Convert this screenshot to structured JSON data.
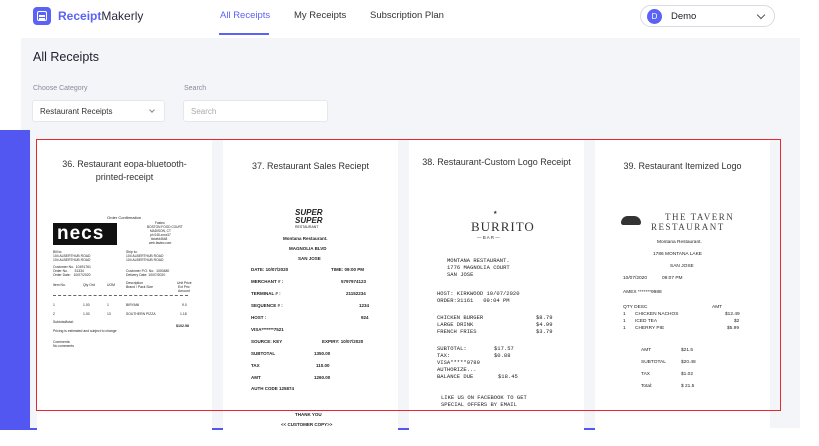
{
  "header": {
    "brand_bold": "Receipt",
    "brand_rest": "Makerly",
    "nav": [
      "All Receipts",
      "My Receipts",
      "Subscription Plan"
    ],
    "user_initial": "D",
    "user_name": "Demo"
  },
  "main": {
    "heading": "All Receipts",
    "category_label": "Choose Category",
    "category_value": "Restaurant Receipts",
    "search_label": "Search",
    "search_placeholder": "Search"
  },
  "cards": [
    {
      "title": "36. Restaurant eopa-bluetooth-printed-receipt",
      "receipt": {
        "confirmation": "Order Confirmation",
        "logo": "necs",
        "store_lines": [
          "Fasteo",
          "BOSTON FOOD COURT",
          "MADISON, CT",
          "ph 045-xxxx37",
          "ticket#4648",
          "web.fasteo.com"
        ],
        "bill_to": [
          "Bill to:",
          "104 ALBERTHUB ROAD",
          "104 ALBERTHUB ROAD"
        ],
        "ship_to": [
          "Ship to:",
          "104 ALBERTHUB ROAD",
          "104 ALBERTHUB ROAD"
        ],
        "meta_left": [
          "Customer No.  10491761",
          "Order No.       31334",
          "Order Date:   10/07/2020"
        ],
        "meta_right": [
          "Customer P.O. No.  1000480",
          "Delivery Date: 10/07/2020"
        ],
        "cols": [
          "Item No.",
          "Qty Ord",
          "UOM",
          "Description",
          "Unit Price"
        ],
        "col_sub": [
          "Brand / Pack Size",
          "Ext Pric",
          "Amount"
        ],
        "rows": [
          [
            "1",
            "1.00",
            "1",
            "BIRYANI",
            "9.0"
          ],
          [
            "2",
            "1.00",
            "13",
            "SOUTHERN PIZZA",
            "1.18"
          ]
        ],
        "subtotal_label": "Subtotal/total:",
        "subtotal_value": "$102.98",
        "note": "Pricing is estimated and subject to change",
        "comments": "Comments:",
        "comments_value": "No comments"
      }
    },
    {
      "title": "37. Restaurant Sales Reciept",
      "receipt": {
        "logo_lines": [
          "SUPER",
          "SUPER"
        ],
        "logo_sub": "RESTAURANT",
        "name": "Montana Restaurant.",
        "street": "MAGNOLIA BLVD",
        "city": "SAN JOSE",
        "date": "DATE: 10/07/2020",
        "time": "TIME: 09:00 PM",
        "rows": [
          [
            "MERCHANT # :",
            "5797974123"
          ],
          [
            "TERMINAL # :",
            "21152234"
          ],
          [
            "SEQUENCE # :",
            "1234"
          ],
          [
            "HOST :",
            "924"
          ]
        ],
        "visa": "VISA*******7521",
        "source": "SOURCE: KEY",
        "expiry": "EXPIRY: 10/07/2020",
        "totals": [
          [
            "SUBTOTAL",
            "1350.00"
          ],
          [
            "TAX",
            "110.00"
          ],
          [
            "AMT",
            "1260.00"
          ]
        ],
        "auth": "AUTH CODE 125874",
        "thanks": "THANK YOU",
        "copy": "<< CUSTOMER COPY>>"
      }
    },
    {
      "title": "38. Restaurant-Custom Logo Receipt",
      "receipt": {
        "logo": "BURRITO",
        "logo_sub": "— B A R —",
        "addr": [
          "MONTANA RESTAURANT.",
          "1776 MAGNOLIA COURT",
          "SAN JOSE"
        ],
        "host": "HOST: KIRKWOOD 10/07/2020",
        "order": "ORDER:31161   09:04 PM",
        "items": [
          [
            "CHICKEN BURGER",
            "$8.79"
          ],
          [
            "LARGE DRINK",
            "$4.99"
          ],
          [
            "FRENCH FRIES",
            "$3.79"
          ]
        ],
        "sums": [
          [
            "SUBTOTAL:",
            "$17.57"
          ],
          [
            "TAX:",
            "$0.88"
          ]
        ],
        "visa": "VISA*****9789",
        "authorize": "AUTHORIZE...",
        "balance": [
          "BALANCE DUE",
          "$18.45"
        ],
        "footer": [
          "LIKE US ON FACEBOOK TO GET",
          "SPECIAL OFFERS BY EMAIL"
        ]
      }
    },
    {
      "title": "39. Restaurant Itemized Logo",
      "receipt": {
        "logo_lines": [
          "THE TAVERN",
          "RESTAURANT"
        ],
        "name": "Montana Restaurant.",
        "street": "1786 MONTANA LAKE",
        "city": "SAN JOSE",
        "date": "10/07/2020",
        "time": "09:07 PM",
        "amex": "AMEX *******9988",
        "head": [
          "QTY DESC",
          "AMT"
        ],
        "items": [
          [
            "1",
            "CHICKEN NACHOS",
            "$12.49"
          ],
          [
            "1",
            "ICED TEA",
            "$2"
          ],
          [
            "1",
            "CHERRY PIE",
            "$5.99"
          ]
        ],
        "totals": [
          [
            "AMT",
            "$21.5"
          ],
          [
            "SUBTOTAL",
            "$20.48"
          ],
          [
            "TAX",
            "$1.02"
          ],
          [
            "Total:",
            "$ 21.5"
          ]
        ]
      }
    }
  ]
}
